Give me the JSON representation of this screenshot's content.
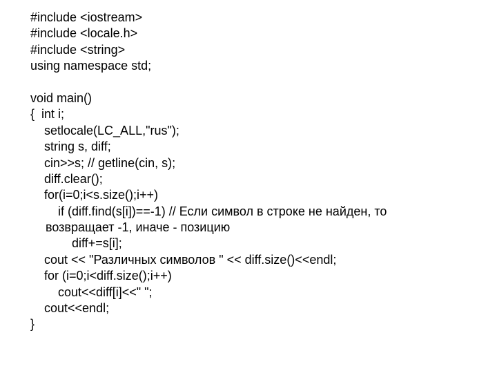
{
  "code": {
    "l01": "#include <iostream>",
    "l02": "#include <locale.h>",
    "l03": "#include <string>",
    "l04": "using namespace std;",
    "l05": "",
    "l06": "void main()",
    "l07": "{  int i;",
    "l08": "setlocale(LC_ALL,\"rus\");",
    "l09": "string s, diff;",
    "l10": "cin>>s; // getline(cin, s);",
    "l11": "diff.clear();",
    "l12": "for(i=0;i<s.size();i++)",
    "l13": "if (diff.find(s[i])==-1) // Если символ в строке не найден, то",
    "l13b": "возвращает -1, иначе - позицию",
    "l14": "diff+=s[i];",
    "l15": "cout << \"Различных символов \" << diff.size()<<endl;",
    "l16": "for (i=0;i<diff.size();i++)",
    "l17": "cout<<diff[i]<<\" \";",
    "l18": "cout<<endl;",
    "l19": "}"
  }
}
